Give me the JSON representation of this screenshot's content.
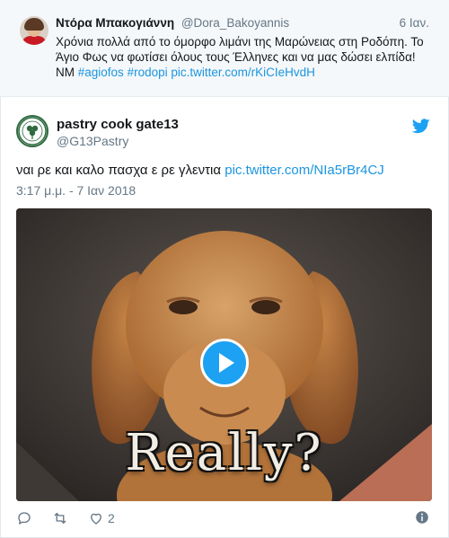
{
  "top_tweet": {
    "name": "Ντόρα Μπακογιάννη",
    "handle": "@Dora_Bakoyannis",
    "time": "6 Ιαν.",
    "text_line1": "Χρόνια πολλά από το όμορφο λιμάνι της Μαρώνειας στη Ροδόπη. Το",
    "text_line2": "Άγιο Φως να φωτίσει όλους τους Έλληνες και να μας δώσει ελπίδα!",
    "text_line3_prefix": "ΝΜ",
    "hashtag1": "#agiofos",
    "hashtag2": "#rodopi",
    "link": "pic.twitter.com/rKiCIeHvdH"
  },
  "tweet": {
    "name": "pastry cook gate13",
    "handle": "@G13Pastry",
    "text": "ναι ρε και καλο πασχα ε ρε γλεντια",
    "link": "pic.twitter.com/NIa5rBr4CJ",
    "timestamp": "3:17 μ.μ. - 7 Ιαν 2018",
    "media_caption": "Really?",
    "like_count": "2"
  },
  "colors": {
    "link": "#1b95e0",
    "twitter_blue": "#1da1f2",
    "secondary_text": "#657786"
  },
  "icons": {
    "reply": "reply-icon",
    "retweet": "retweet-icon",
    "like": "heart-icon",
    "info": "info-icon",
    "brand": "twitter-bird-icon",
    "play": "play-icon"
  }
}
